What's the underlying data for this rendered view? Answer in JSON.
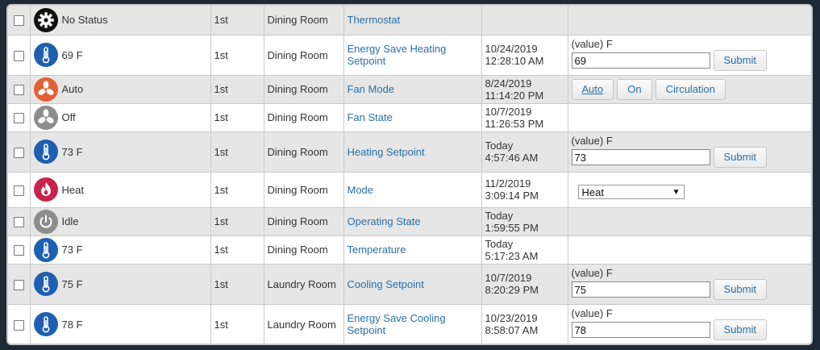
{
  "colors": {
    "link": "#2a6fa5",
    "icon_thermo": "#1f5fb0",
    "icon_fan_active": "#e35f35",
    "icon_gray": "#8d8d8d",
    "icon_heat": "#c8234a",
    "icon_settings": "#111111"
  },
  "rows": [
    {
      "icon": "gear-icon",
      "status": "No Status",
      "floor": "1st",
      "room": "Dining Room",
      "name": "Thermostat",
      "time": [
        "",
        ""
      ],
      "control": "none"
    },
    {
      "icon": "thermometer-icon",
      "status": "69 F",
      "floor": "1st",
      "room": "Dining Room",
      "name": "Energy Save Heating Setpoint",
      "time": [
        "10/24/2019",
        "12:28:10 AM"
      ],
      "control": "value",
      "control_label": "(value) F",
      "value": "69",
      "submit": "Submit"
    },
    {
      "icon": "fan-icon",
      "status": "Auto",
      "floor": "1st",
      "room": "Dining Room",
      "name": "Fan Mode",
      "time": [
        "8/24/2019",
        "11:14:20 PM"
      ],
      "control": "buttons",
      "buttons": [
        "Auto",
        "On",
        "Circulation"
      ]
    },
    {
      "icon": "fan-off-icon",
      "status": "Off",
      "floor": "1st",
      "room": "Dining Room",
      "name": "Fan State",
      "time": [
        "10/7/2019",
        "11:26:53 PM"
      ],
      "control": "none"
    },
    {
      "icon": "thermometer-icon",
      "status": "73 F",
      "floor": "1st",
      "room": "Dining Room",
      "name": "Heating Setpoint",
      "time": [
        "Today",
        "4:57:46 AM"
      ],
      "control": "value",
      "control_label": "(value) F",
      "value": "73",
      "submit": "Submit"
    },
    {
      "icon": "flame-icon",
      "status": "Heat",
      "floor": "1st",
      "room": "Dining Room",
      "name": "Mode",
      "time": [
        "11/2/2019",
        "3:09:14 PM"
      ],
      "control": "select",
      "selected": "Heat"
    },
    {
      "icon": "power-icon",
      "status": "Idle",
      "floor": "1st",
      "room": "Dining Room",
      "name": "Operating State",
      "time": [
        "Today",
        "1:59:55 PM"
      ],
      "control": "none"
    },
    {
      "icon": "thermometer-icon",
      "status": "73 F",
      "floor": "1st",
      "room": "Dining Room",
      "name": "Temperature",
      "time": [
        "Today",
        "5:17:23 AM"
      ],
      "control": "none"
    },
    {
      "icon": "thermometer-icon",
      "status": "75 F",
      "floor": "1st",
      "room": "Laundry Room",
      "name": "Cooling Setpoint",
      "time": [
        "10/7/2019",
        "8:20:29 PM"
      ],
      "control": "value",
      "control_label": "(value) F",
      "value": "75",
      "submit": "Submit"
    },
    {
      "icon": "thermometer-icon",
      "status": "78 F",
      "floor": "1st",
      "room": "Laundry Room",
      "name": "Energy Save Cooling Setpoint",
      "time": [
        "10/23/2019",
        "8:58:07 AM"
      ],
      "control": "value",
      "control_label": "(value) F",
      "value": "78",
      "submit": "Submit"
    }
  ]
}
